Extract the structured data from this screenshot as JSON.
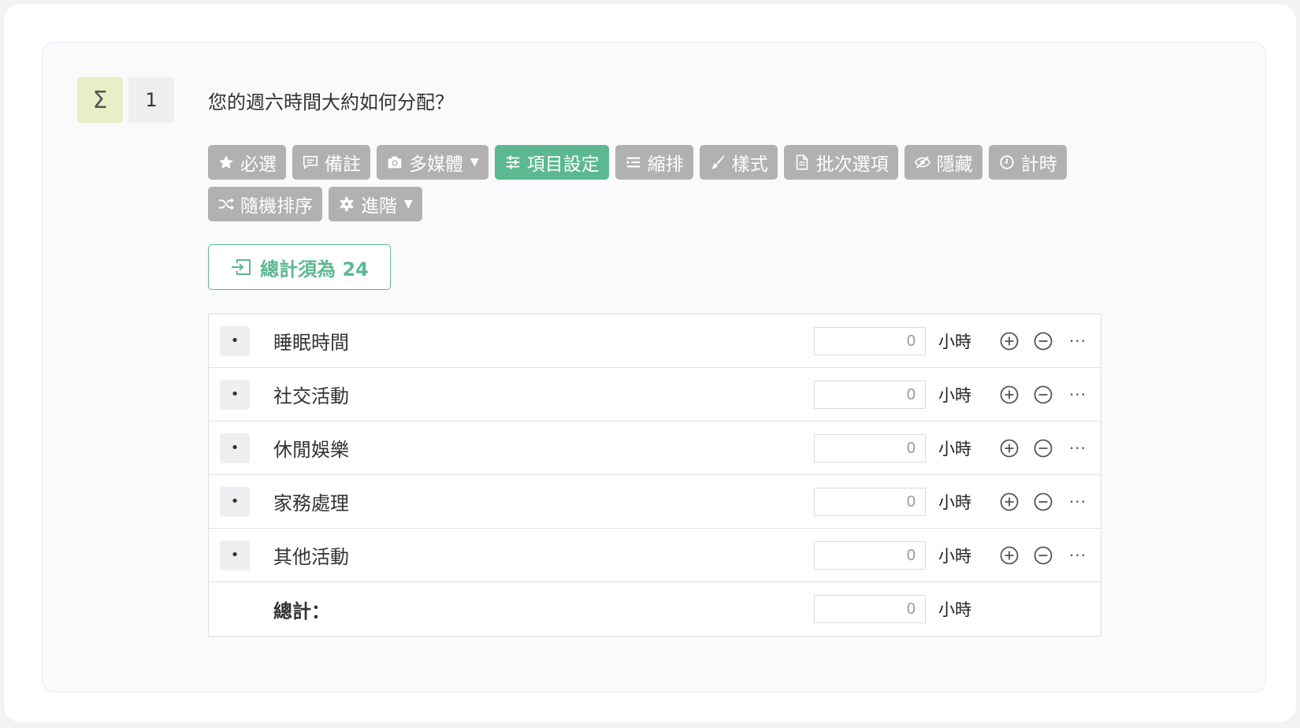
{
  "question": {
    "type_icon": "sigma-icon",
    "type_symbol": "Σ",
    "number": "1",
    "title": "您的週六時間大約如何分配？"
  },
  "toolbar": {
    "required": "必選",
    "note": "備註",
    "media": "多媒體",
    "item_settings": "項目設定",
    "indent": "縮排",
    "style": "樣式",
    "batch_options": "批次選項",
    "hide": "隱藏",
    "timer": "計時",
    "random_order": "隨機排序",
    "advanced": "進階",
    "active_color": "#5cb891",
    "button_color": "#b1b1b3"
  },
  "sum_rule": {
    "label": "總計須為 24"
  },
  "rows": [
    {
      "bullet": "•",
      "label": "睡眠時間",
      "value": "0",
      "unit": "小時",
      "more": "···"
    },
    {
      "bullet": "•",
      "label": "社交活動",
      "value": "0",
      "unit": "小時",
      "more": "···"
    },
    {
      "bullet": "•",
      "label": "休閒娛樂",
      "value": "0",
      "unit": "小時",
      "more": "···"
    },
    {
      "bullet": "•",
      "label": "家務處理",
      "value": "0",
      "unit": "小時",
      "more": "···"
    },
    {
      "bullet": "•",
      "label": "其他活動",
      "value": "0",
      "unit": "小時",
      "more": "···"
    }
  ],
  "total": {
    "label": "總計：",
    "value": "0",
    "unit": "小時"
  }
}
